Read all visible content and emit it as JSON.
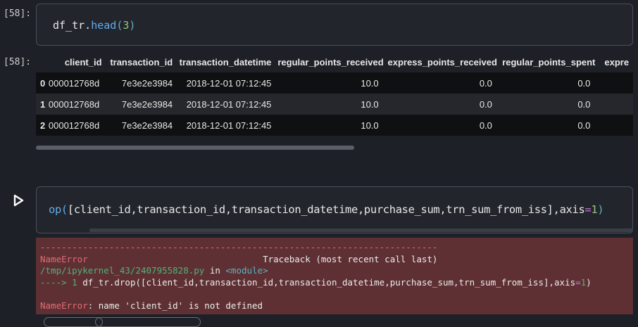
{
  "cell1": {
    "prompt": "[58]:",
    "code": {
      "obj": "df_tr.",
      "fn": "head",
      "open": "(",
      "arg": "3",
      "close": ")"
    }
  },
  "output1": {
    "prompt": "[58]:",
    "columns": [
      "",
      "client_id",
      "transaction_id",
      "transaction_datetime",
      "regular_points_received",
      "express_points_received",
      "regular_points_spent",
      "expre"
    ],
    "rows": [
      [
        "0",
        "000012768d",
        "7e3e2e3984",
        "2018-12-01 07:12:45",
        "10.0",
        "0.0",
        "0.0",
        ""
      ],
      [
        "1",
        "000012768d",
        "7e3e2e3984",
        "2018-12-01 07:12:45",
        "10.0",
        "0.0",
        "0.0",
        ""
      ],
      [
        "2",
        "000012768d",
        "7e3e2e3984",
        "2018-12-01 07:12:45",
        "10.0",
        "0.0",
        "0.0",
        ""
      ]
    ]
  },
  "cell2": {
    "code_pre": "op(",
    "code_list": "[client_id,transaction_id,transaction_datetime,purchase_sum,trn_sum_from_iss],axis",
    "code_eq": "=",
    "code_num": "1",
    "code_close": ")"
  },
  "error": {
    "dashes": "---------------------------------------------------------------------------",
    "name": "NameError",
    "traceback": "Traceback (most recent call last)",
    "file": "/tmp/ipykernel_43/2407955828.py",
    "in_word": " in ",
    "module": "<module>",
    "arrow": "----> 1 ",
    "line_code_a": "df_tr.drop(",
    "line_code_b": "[client_id,transaction_id,transaction_datetime,purchase_sum,trn_sum_from_iss],axis",
    "line_code_eq": "=",
    "line_code_num": "1",
    "line_code_c": ")",
    "message_name": "NameError",
    "message": ": name 'client_id' is not defined"
  },
  "colors": {
    "background": "#1e2027",
    "error_bg": "#5e3033",
    "function_blue": "#61afef",
    "number_green": "#98c379"
  }
}
